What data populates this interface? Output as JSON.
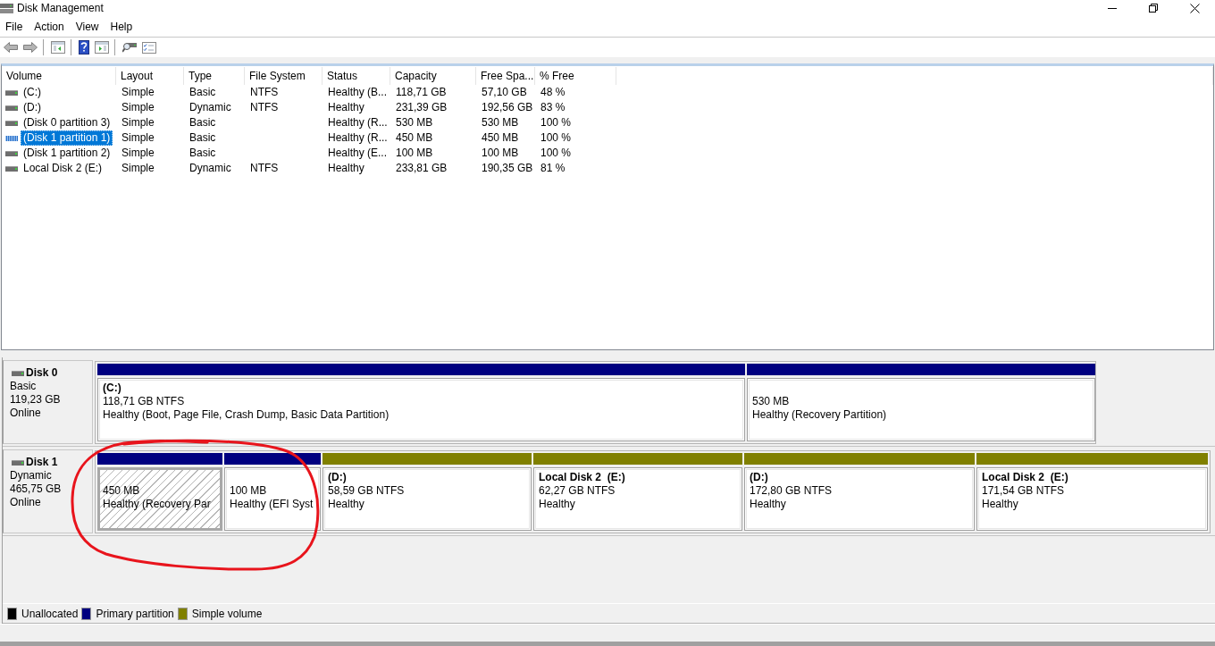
{
  "window": {
    "title": "Disk Management"
  },
  "menu": [
    "File",
    "Action",
    "View",
    "Help"
  ],
  "volume_table": {
    "columns": [
      "Volume",
      "Layout",
      "Type",
      "File System",
      "Status",
      "Capacity",
      "Free Spa...",
      "% Free"
    ],
    "rows": [
      {
        "volume": "(C:)",
        "layout": "Simple",
        "type": "Basic",
        "file_system": "NTFS",
        "status": "Healthy (B...",
        "capacity": "118,71 GB",
        "free_space": "57,10 GB",
        "percent_free": "48 %",
        "selected": false
      },
      {
        "volume": "(D:)",
        "layout": "Simple",
        "type": "Dynamic",
        "file_system": "NTFS",
        "status": "Healthy",
        "capacity": "231,39 GB",
        "free_space": "192,56 GB",
        "percent_free": "83 %",
        "selected": false
      },
      {
        "volume": "(Disk 0 partition 3)",
        "layout": "Simple",
        "type": "Basic",
        "status": "Healthy (R...",
        "capacity": "530 MB",
        "free_space": "530 MB",
        "percent_free": "100 %",
        "selected": false
      },
      {
        "volume": "(Disk 1 partition 1)",
        "layout": "Simple",
        "type": "Basic",
        "status": "Healthy (R...",
        "capacity": "450 MB",
        "free_space": "450 MB",
        "percent_free": "100 %",
        "selected": true
      },
      {
        "volume": "(Disk 1 partition 2)",
        "layout": "Simple",
        "type": "Basic",
        "status": "Healthy (E...",
        "capacity": "100 MB",
        "free_space": "100 MB",
        "percent_free": "100 %",
        "selected": false
      },
      {
        "volume": "Local Disk 2 (E:)",
        "layout": "Simple",
        "type": "Dynamic",
        "file_system": "NTFS",
        "status": "Healthy",
        "capacity": "233,81 GB",
        "free_space": "190,35 GB",
        "percent_free": "81 %",
        "selected": false
      }
    ]
  },
  "disks": [
    {
      "name": "Disk 0",
      "type": "Basic",
      "size": "119,23 GB",
      "status": "Online",
      "partitions": [
        {
          "name": "(C:)",
          "size": "118,71 GB NTFS",
          "status": "Healthy (Boot, Page File, Crash Dump, Basic Data Partition)",
          "color": "#000080",
          "selected": false,
          "circled": false
        },
        {
          "size": "530 MB",
          "status": "Healthy (Recovery Partition)",
          "color": "#000080",
          "selected": false,
          "circled": false
        }
      ]
    },
    {
      "name": "Disk 1",
      "type": "Dynamic",
      "size": "465,75 GB",
      "status": "Online",
      "partitions": [
        {
          "size": "450 MB",
          "status": "Healthy (Recovery Par",
          "color": "#000080",
          "selected": true,
          "circled": true
        },
        {
          "size": "100 MB",
          "status": "Healthy (EFI Syst",
          "color": "#000080",
          "selected": false,
          "circled": true
        },
        {
          "name": "(D:)",
          "size": "58,59 GB NTFS",
          "status": "Healthy",
          "color": "#808000",
          "selected": false,
          "circled": false
        },
        {
          "name": "Local Disk 2  (E:)",
          "size": "62,27 GB NTFS",
          "status": "Healthy",
          "color": "#808000",
          "selected": false,
          "circled": false
        },
        {
          "name": "(D:)",
          "size": "172,80 GB NTFS",
          "status": "Healthy",
          "color": "#808000",
          "selected": false,
          "circled": false
        },
        {
          "name": "Local Disk 2  (E:)",
          "size": "171,54 GB NTFS",
          "status": "Healthy",
          "color": "#808000",
          "selected": false,
          "circled": false
        }
      ]
    }
  ],
  "legend": [
    {
      "label": "Unallocated",
      "color": "#000000"
    },
    {
      "label": "Primary partition",
      "color": "#000080"
    },
    {
      "label": "Simple volume",
      "color": "#808000"
    }
  ]
}
